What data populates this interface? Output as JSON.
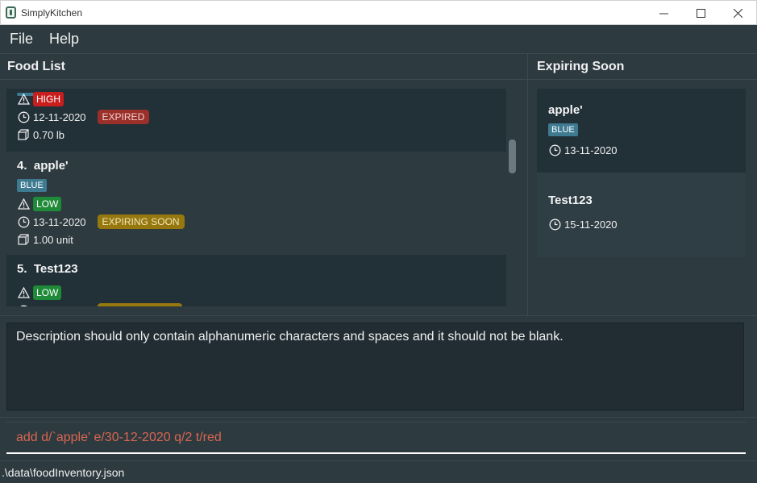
{
  "window": {
    "title": "SimplyKitchen"
  },
  "menu": {
    "file": "File",
    "help": "Help"
  },
  "panels": {
    "food_list_title": "Food List",
    "expiring_title": "Expiring Soon"
  },
  "food_list": [
    {
      "priority": "HIGH",
      "date": "12-11-2020",
      "status": "EXPIRED",
      "quantity": "0.70 lb"
    },
    {
      "index": "4.",
      "name": "apple'",
      "tag": "BLUE",
      "priority": "LOW",
      "date": "13-11-2020",
      "status": "EXPIRING SOON",
      "quantity": "1.00 unit"
    },
    {
      "index": "5.",
      "name": "Test123",
      "priority": "LOW"
    }
  ],
  "expiring_soon": [
    {
      "name": "apple'",
      "tag": "BLUE",
      "date": "13-11-2020"
    },
    {
      "name": "Test123",
      "date": "15-11-2020"
    }
  ],
  "result_message": "Description should only contain alphanumeric characters and spaces and it should not be blank.",
  "command_input": {
    "value": "add d/`apple' e/30-12-2020 q/2 t/red"
  },
  "status_bar": {
    "path": ".\\data\\foodInventory.json"
  },
  "colors": {
    "background": "#2d3a40",
    "card_dark": "#223038",
    "tag_blue": "#3e7b91",
    "priority_high": "#c81e1e",
    "priority_low": "#1f8a38",
    "expired": "#9b2f2a",
    "expiring_soon": "#96780f",
    "command_text": "#d9664f"
  }
}
